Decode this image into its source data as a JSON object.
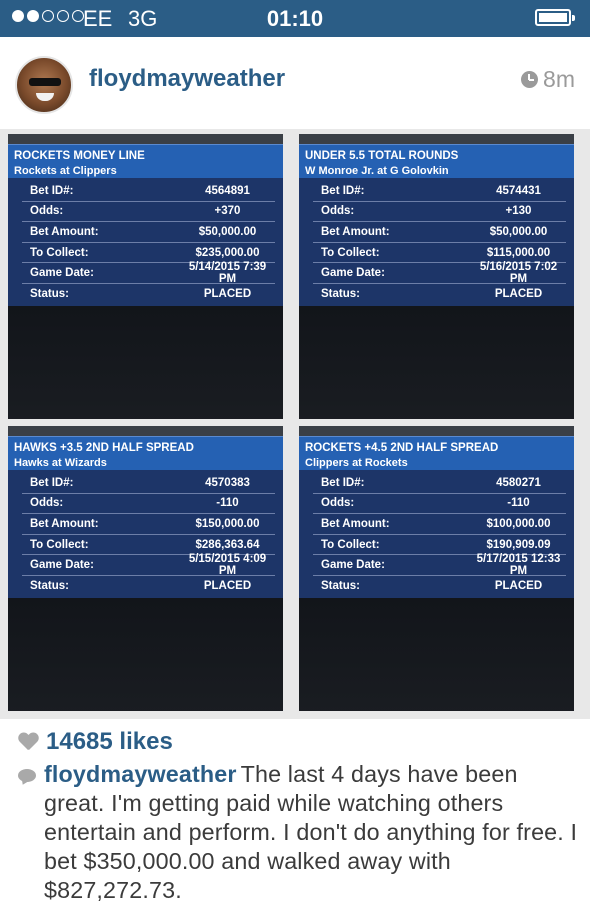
{
  "status_bar": {
    "signal": {
      "filled": 2,
      "total": 5
    },
    "carrier": "EE",
    "network": "3G",
    "time": "01:10",
    "battery_level": 1.0
  },
  "post": {
    "username": "floydmayweather",
    "time_ago": "8m",
    "likes": "14685 likes",
    "caption_user": "floydmayweather",
    "caption": "The last 4 days have been great. I'm getting paid while watching others entertain and perform. I don't do anything for free. I bet $350,000.00 and walked away with $827,272.73."
  },
  "labels": {
    "bet_id": "Bet ID#:",
    "odds": "Odds:",
    "bet_amount": "Bet Amount:",
    "to_collect": "To Collect:",
    "game_date": "Game Date:",
    "status": "Status:"
  },
  "bets": [
    {
      "title": "ROCKETS  MONEY LINE",
      "matchup": "Rockets at Clippers",
      "bet_id": "4564891",
      "odds": "+370",
      "bet_amount": "$50,000.00",
      "to_collect": "$235,000.00",
      "game_date": "5/14/2015 7:39 PM",
      "status": "PLACED"
    },
    {
      "title": "UNDER 5.5 TOTAL ROUNDS",
      "matchup": "W Monroe Jr. at G Golovkin",
      "bet_id": "4574431",
      "odds": "+130",
      "bet_amount": "$50,000.00",
      "to_collect": "$115,000.00",
      "game_date": "5/16/2015 7:02 PM",
      "status": "PLACED"
    },
    {
      "title": "HAWKS +3.5 2ND HALF SPREAD",
      "matchup": "Hawks at Wizards",
      "bet_id": "4570383",
      "odds": "-110",
      "bet_amount": "$150,000.00",
      "to_collect": "$286,363.64",
      "game_date": "5/15/2015 4:09 PM",
      "status": "PLACED"
    },
    {
      "title": "ROCKETS +4.5 2ND HALF SPREAD",
      "matchup": "Clippers at Rockets",
      "bet_id": "4580271",
      "odds": "-110",
      "bet_amount": "$100,000.00",
      "to_collect": "$190,909.09",
      "game_date": "5/17/2015 12:33 PM",
      "status": "PLACED"
    }
  ],
  "colors": {
    "status_bar_bg": "#2b5d86",
    "link_blue": "#2b5d86",
    "card_header_blue": "#2561b3",
    "card_rows_navy": "#1d3568",
    "card_bg_dark": "#15191f",
    "icon_gray": "#a9a9a9"
  },
  "icons": {
    "signal": "signal-dots-icon",
    "battery": "battery-icon",
    "clock": "clock-icon",
    "heart": "heart-icon",
    "comment": "comment-bubble-icon"
  }
}
